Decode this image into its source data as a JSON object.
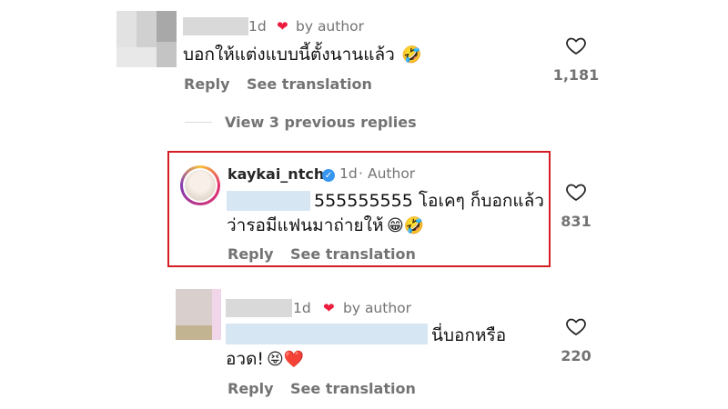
{
  "colors": {
    "highlight": "#d51d24",
    "author_heart": "#ed1c3c",
    "verified": "#3797f0",
    "muted": "#737373"
  },
  "comment1": {
    "time": "1d",
    "by_author": "by author",
    "text": "บอกให้แต่งแบบนี้ตั้งนานแล้ว",
    "emoji": "🤣",
    "reply": "Reply",
    "see_translation": "See translation",
    "likes": "1,181"
  },
  "view_previous": "View 3 previous replies",
  "comment2": {
    "username": "kaykai_ntch",
    "time": "1d",
    "separator": "·",
    "author_label": "Author",
    "text_line1": "555555555 โอเคๆ ก็บอกแล้ว",
    "text_line2": "ว่ารอมีแฟนมาถ่ายให้",
    "emojis": "😁🤣",
    "reply": "Reply",
    "see_translation": "See translation",
    "likes": "831"
  },
  "comment3": {
    "time": "1d",
    "by_author": "by author",
    "text_line1": "นี่บอกหรือ",
    "text_line2": "อวด!",
    "emojis": "😝❤️",
    "reply": "Reply",
    "see_translation": "See translation",
    "likes": "220"
  }
}
